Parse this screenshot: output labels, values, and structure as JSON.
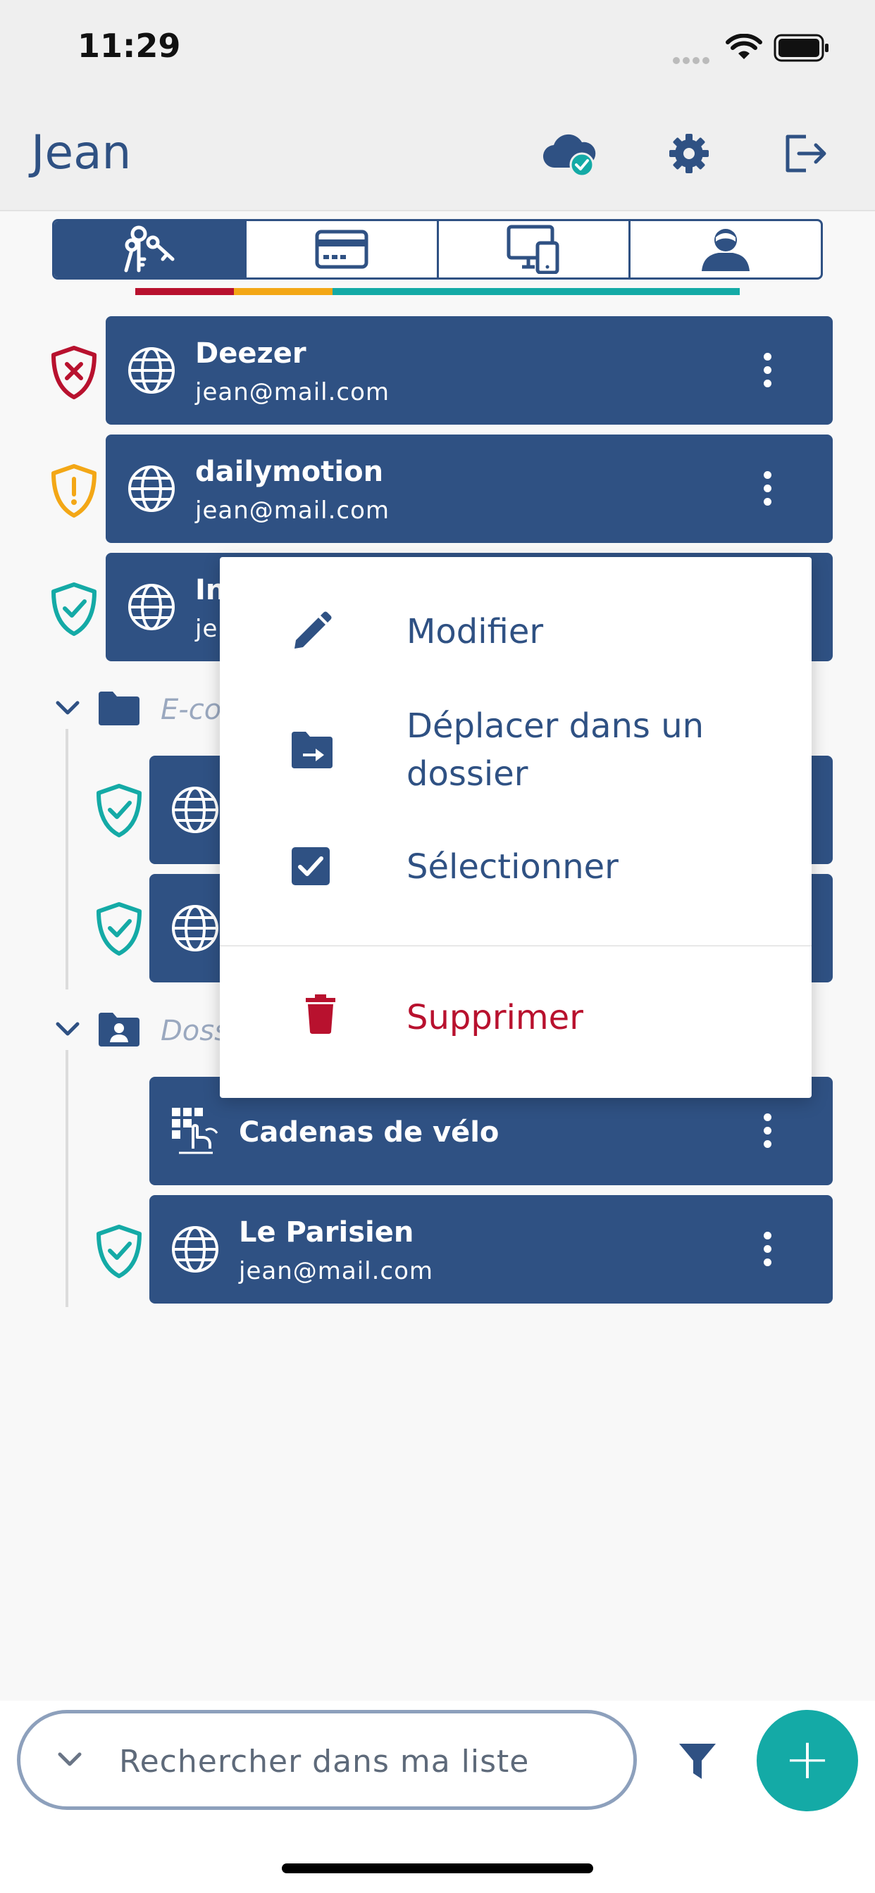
{
  "status_bar": {
    "time": "11:29"
  },
  "header": {
    "title": "Jean",
    "icons": [
      "cloud-check-icon",
      "gear-icon",
      "logout-icon"
    ]
  },
  "tabs": [
    {
      "name": "keys-icon",
      "active": true
    },
    {
      "name": "credit-card-icon",
      "active": false
    },
    {
      "name": "devices-icon",
      "active": false
    },
    {
      "name": "contact-icon",
      "active": false
    }
  ],
  "strength_colors": {
    "weak": "#b8112e",
    "medium": "#f3a716",
    "strong": "#14aaa6"
  },
  "entries": [
    {
      "title": "Deezer",
      "subtitle": "jean@mail.com",
      "status": "weak"
    },
    {
      "title": "dailymotion",
      "subtitle": "jean@mail.com",
      "status": "medium"
    },
    {
      "title": "In",
      "subtitle": "je",
      "status": "strong"
    }
  ],
  "folders": [
    {
      "label": "E-co",
      "items": [
        {
          "title": "",
          "subtitle": "",
          "status": "strong"
        },
        {
          "title": "",
          "subtitle": "",
          "status": "strong"
        }
      ]
    },
    {
      "label": "Doss",
      "items": [
        {
          "title": "Cadenas de vélo",
          "subtitle": "",
          "status": "none"
        },
        {
          "title": "Le Parisien",
          "subtitle": "jean@mail.com",
          "status": "strong"
        }
      ]
    }
  ],
  "context_menu": {
    "edit": "Modifier",
    "move_line1": "Déplacer dans un",
    "move_line2": "dossier",
    "select": "Sélectionner",
    "delete": "Supprimer"
  },
  "search": {
    "placeholder": "Rechercher dans ma liste"
  },
  "fab_label": "+"
}
